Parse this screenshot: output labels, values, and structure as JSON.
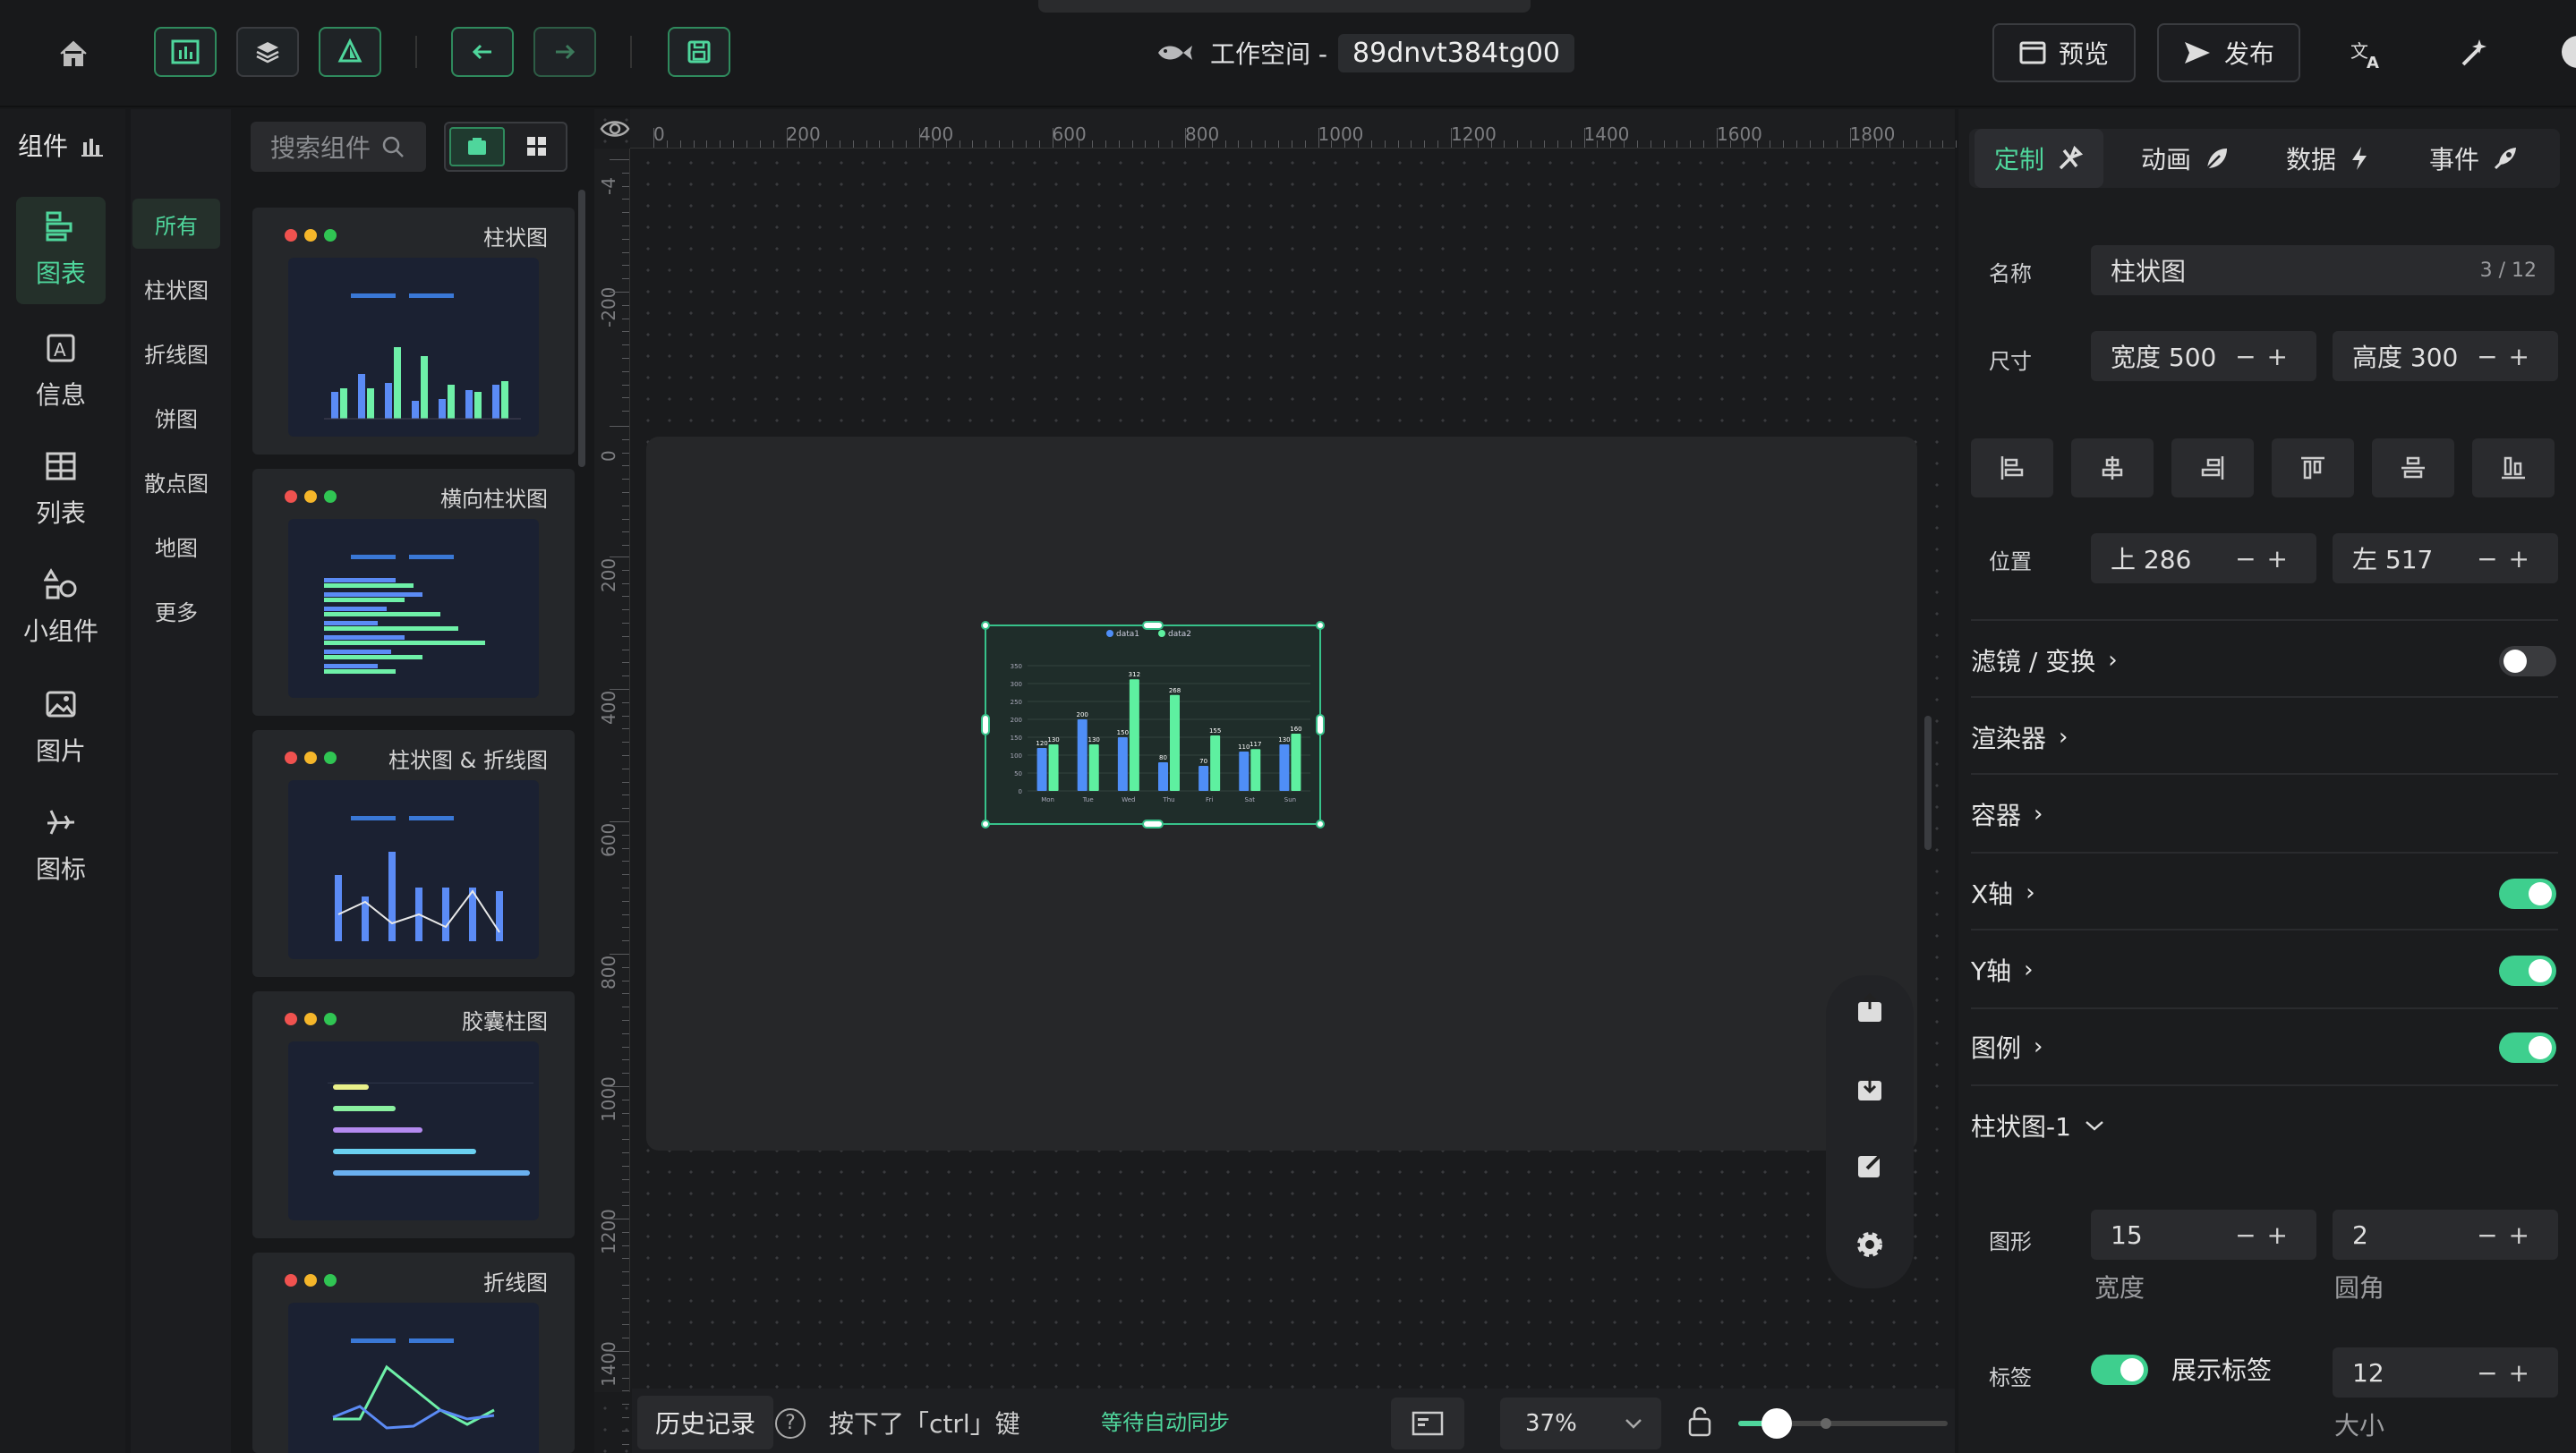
{
  "topbar": {
    "workspace_label": "工作空间 -",
    "workspace_id": "89dnvt384tg00",
    "preview_label": "预览",
    "publish_label": "发布"
  },
  "left": {
    "panel_title": "组件",
    "search_placeholder": "搜索组件",
    "categories": [
      "图表",
      "信息",
      "列表",
      "小组件",
      "图片",
      "图标"
    ],
    "subcategories": [
      "所有",
      "柱状图",
      "折线图",
      "饼图",
      "散点图",
      "地图",
      "更多"
    ],
    "cards": [
      "柱状图",
      "横向柱状图",
      "柱状图 & 折线图",
      "胶囊柱图",
      "折线图"
    ]
  },
  "rulers": {
    "h_ticks": [
      "0",
      "200",
      "400",
      "600",
      "800",
      "1000",
      "1200",
      "1400",
      "1600",
      "1800"
    ],
    "v_ticks": [
      "-4",
      "-200",
      "0",
      "200",
      "400",
      "600",
      "800",
      "1000",
      "1200",
      "1400"
    ]
  },
  "chart_data": {
    "type": "bar",
    "categories": [
      "Mon",
      "Tue",
      "Wed",
      "Thu",
      "Fri",
      "Sat",
      "Sun"
    ],
    "series": [
      {
        "name": "data1",
        "values": [
          120,
          200,
          150,
          80,
          70,
          110,
          130
        ]
      },
      {
        "name": "data2",
        "values": [
          130,
          130,
          312,
          268,
          155,
          117,
          160
        ]
      }
    ],
    "ylim": [
      0,
      350
    ],
    "yticks": [
      "0",
      "50",
      "100",
      "150",
      "200",
      "250",
      "300",
      "350"
    ],
    "data_labels": true,
    "legend_position": "top",
    "colors": {
      "data1": "#4f8ef7",
      "data2": "#5ef0a0"
    }
  },
  "bottom": {
    "history_label": "历史记录",
    "key_message": "按下了「ctrl」键",
    "sync_status": "等待自动同步",
    "zoom": "37%"
  },
  "right": {
    "tabs": [
      "定制",
      "动画",
      "数据",
      "事件"
    ],
    "name_label": "名称",
    "name_value": "柱状图",
    "name_count": "3 / 12",
    "size_label": "尺寸",
    "width_value": "宽度 500",
    "height_value": "高度 300",
    "pos_label": "位置",
    "top_value": "上 286",
    "left_value": "左 517",
    "sections": [
      {
        "label": "滤镜 / 变换",
        "toggle": "off"
      },
      {
        "label": "渲染器",
        "toggle": ""
      },
      {
        "label": "容器",
        "toggle": ""
      },
      {
        "label": "X轴",
        "toggle": "on"
      },
      {
        "label": "Y轴",
        "toggle": "on"
      },
      {
        "label": "图例",
        "toggle": "on"
      }
    ],
    "series_section": "柱状图-1",
    "shape_label": "图形",
    "shape_width": "15",
    "shape_width_caption": "宽度",
    "shape_radius": "2",
    "shape_radius_caption": "圆角",
    "tag_label": "标签",
    "show_label": "展示标签",
    "tag_size": "12",
    "tag_size_caption": "大小"
  }
}
